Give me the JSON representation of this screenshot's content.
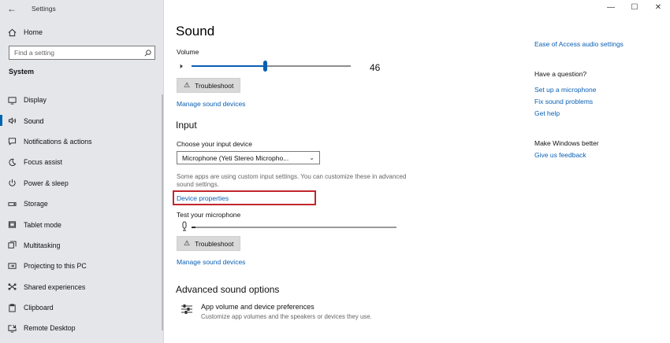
{
  "window": {
    "title": "Settings",
    "minimize": "—",
    "maximize": "☐",
    "close": "✕"
  },
  "sidebar": {
    "home_label": "Home",
    "search_placeholder": "Find a setting",
    "section_label": "System",
    "items": [
      {
        "label": "Display",
        "icon": "display-icon",
        "active": false
      },
      {
        "label": "Sound",
        "icon": "speaker-icon",
        "active": true
      },
      {
        "label": "Notifications & actions",
        "icon": "notifications-icon",
        "active": false
      },
      {
        "label": "Focus assist",
        "icon": "moon-icon",
        "active": false
      },
      {
        "label": "Power & sleep",
        "icon": "power-icon",
        "active": false
      },
      {
        "label": "Storage",
        "icon": "storage-icon",
        "active": false
      },
      {
        "label": "Tablet mode",
        "icon": "tablet-icon",
        "active": false
      },
      {
        "label": "Multitasking",
        "icon": "multitasking-icon",
        "active": false
      },
      {
        "label": "Projecting to this PC",
        "icon": "projector-icon",
        "active": false
      },
      {
        "label": "Shared experiences",
        "icon": "shared-icon",
        "active": false
      },
      {
        "label": "Clipboard",
        "icon": "clipboard-icon",
        "active": false
      },
      {
        "label": "Remote Desktop",
        "icon": "remote-icon",
        "active": false
      }
    ]
  },
  "main": {
    "title": "Sound",
    "output": {
      "volume_label": "Volume",
      "volume_value": "46",
      "volume_level": 0.46,
      "troubleshoot_label": "Troubleshoot",
      "manage_link": "Manage sound devices"
    },
    "input": {
      "heading": "Input",
      "choose_label": "Choose your input device",
      "selected_device": "Microphone (Yeti Stereo Micropho...",
      "note": "Some apps are using custom input settings. You can customize these in advanced sound settings.",
      "device_properties_link": "Device properties",
      "test_label": "Test your microphone",
      "mic_level": 0.02,
      "troubleshoot_label": "Troubleshoot",
      "manage_link": "Manage sound devices"
    },
    "advanced": {
      "heading": "Advanced sound options",
      "item_title": "App volume and device preferences",
      "item_desc": "Customize app volumes and the speakers or devices they use."
    }
  },
  "related": {
    "ease_link": "Ease of Access audio settings",
    "question_heading": "Have a question?",
    "links": [
      "Set up a microphone",
      "Fix sound problems",
      "Get help"
    ],
    "better_heading": "Make Windows better",
    "feedback_link": "Give us feedback"
  },
  "colors": {
    "accent": "#0a5fb4",
    "highlight": "#c1272d",
    "sidebar_bg": "#e4e6ea"
  }
}
